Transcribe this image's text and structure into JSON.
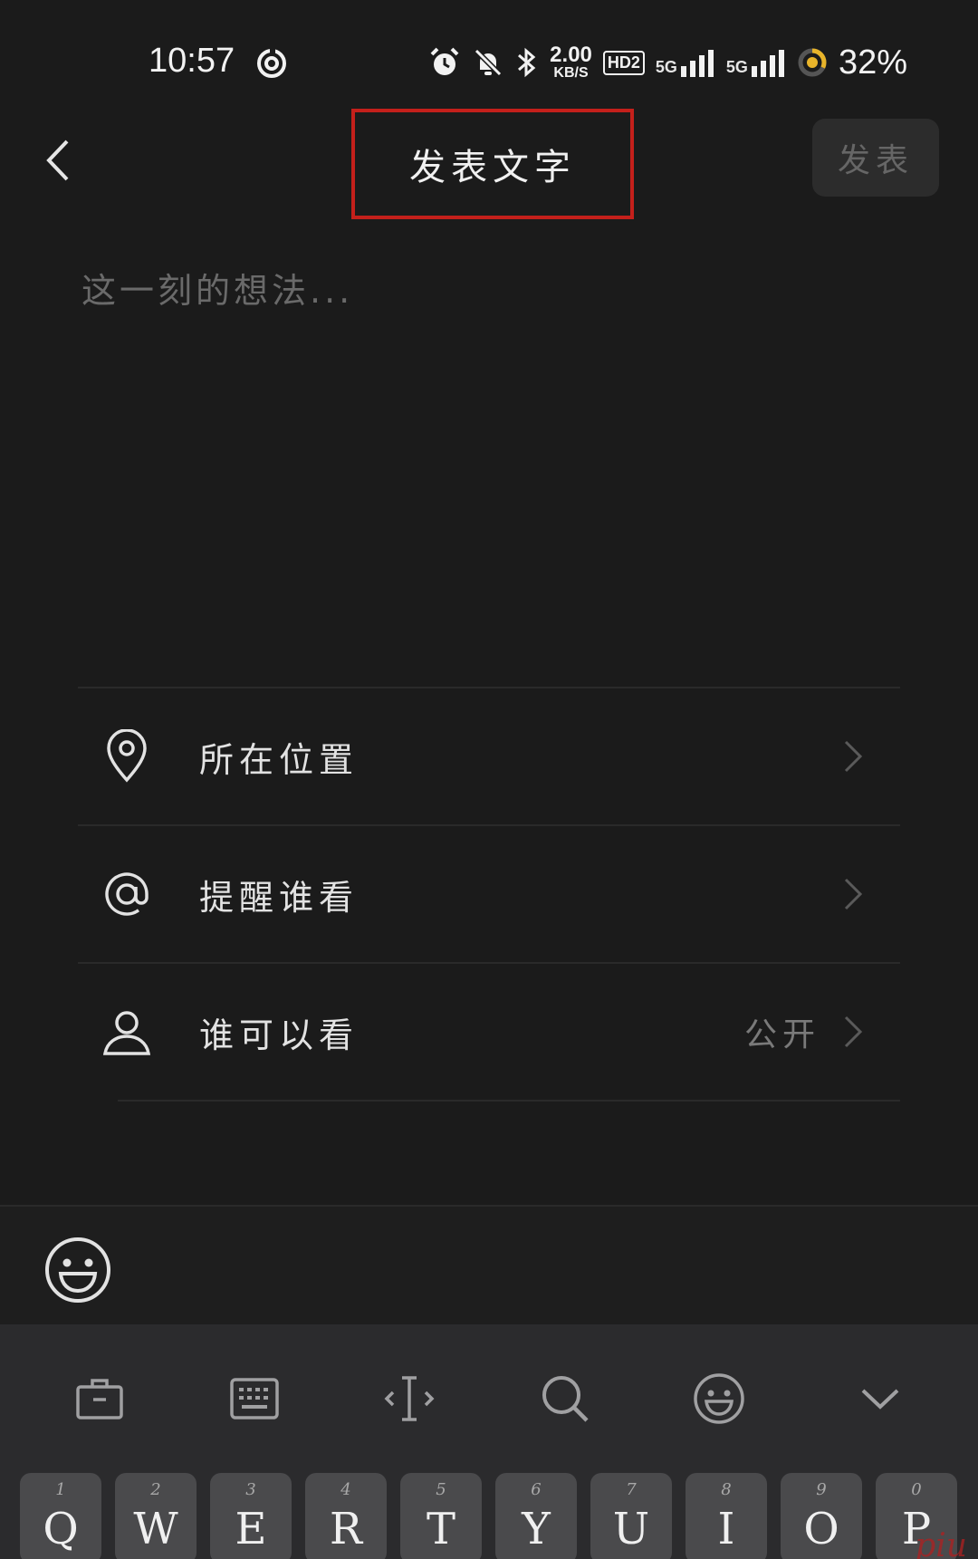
{
  "status_bar": {
    "time": "10:57",
    "net_speed_value": "2.00",
    "net_speed_unit": "KB/S",
    "hd_badge": "HD2",
    "signal_1": "5G",
    "signal_2": "5G",
    "battery": "32%"
  },
  "header": {
    "title": "发表文字",
    "publish_label": "发表"
  },
  "compose": {
    "value": "",
    "placeholder": "这一刻的想法..."
  },
  "options": [
    {
      "label": "所在位置",
      "icon": "location-pin-icon",
      "value": ""
    },
    {
      "label": "提醒谁看",
      "icon": "at-sign-icon",
      "value": ""
    },
    {
      "label": "谁可以看",
      "icon": "user-icon",
      "value": "公开"
    }
  ],
  "keyboard": {
    "toolbar": [
      "toolbox-icon",
      "keyboard-layout-icon",
      "cursor-move-icon",
      "search-icon",
      "emoji-icon",
      "collapse-icon"
    ],
    "keys": [
      {
        "hint": "1",
        "char": "Q"
      },
      {
        "hint": "2",
        "char": "W"
      },
      {
        "hint": "3",
        "char": "E"
      },
      {
        "hint": "4",
        "char": "R"
      },
      {
        "hint": "5",
        "char": "T"
      },
      {
        "hint": "6",
        "char": "Y"
      },
      {
        "hint": "7",
        "char": "U"
      },
      {
        "hint": "8",
        "char": "I"
      },
      {
        "hint": "9",
        "char": "O"
      },
      {
        "hint": "0",
        "char": "P"
      }
    ]
  },
  "watermark": "piu",
  "colors": {
    "background": "#1b1b1b",
    "highlight_box": "#c4201b",
    "battery_ring": "#e8b42a"
  }
}
